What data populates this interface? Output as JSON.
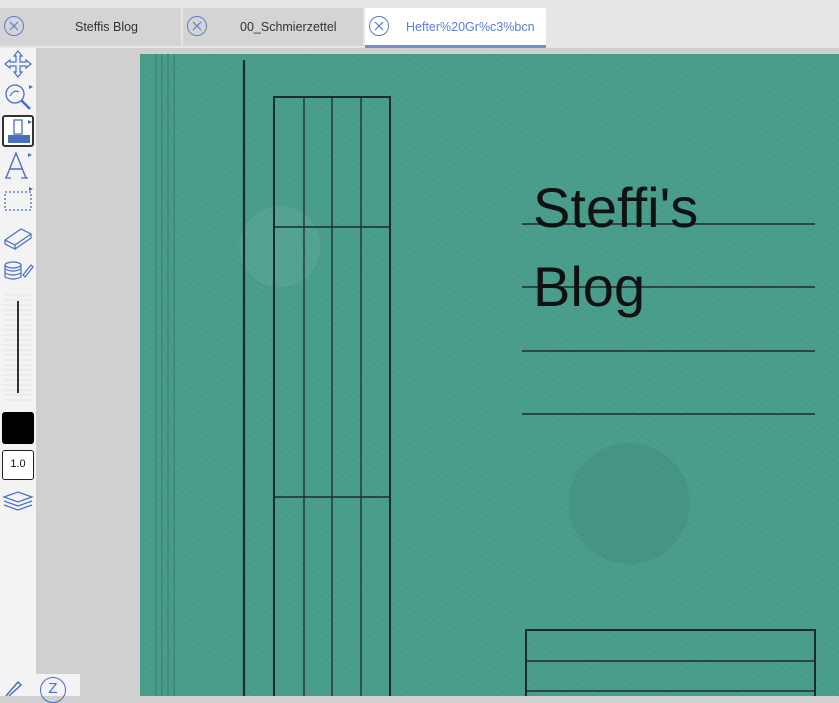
{
  "tabs": [
    {
      "label": "Steffis Blog",
      "active": false
    },
    {
      "label": "00_Schmierzettel",
      "active": false
    },
    {
      "label": "Hefter%20Gr%c3%bcn",
      "active": true
    }
  ],
  "toolbar": {
    "tools": [
      "move-tool-icon",
      "zoom-tool-icon",
      "pen-tool-icon",
      "text-tool-icon",
      "select-rect-tool-icon",
      "eraser-tool-icon",
      "layers-pen-icon"
    ],
    "line_width": "1.0",
    "color": "#000000"
  },
  "page": {
    "title": "Steffi's\nBlog",
    "background": "#4a9e8c"
  },
  "bottom": {
    "z_label": "Z"
  }
}
